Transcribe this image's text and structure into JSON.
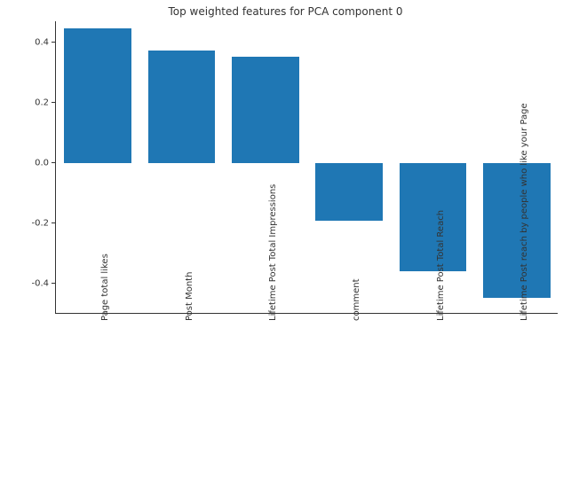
{
  "chart_data": {
    "type": "bar",
    "title": "Top weighted features for PCA component 0",
    "xlabel": "",
    "ylabel": "",
    "ylim": [
      -0.5,
      0.47
    ],
    "yticks": [
      -0.4,
      -0.2,
      0.0,
      0.2,
      0.4
    ],
    "categories": [
      "Page total likes",
      "Post Month",
      "Lifetime Post Total Impressions",
      "comment",
      "Lifetime Post Total Reach",
      "Lifetime Post reach by people who like your Page"
    ],
    "values": [
      0.447,
      0.372,
      0.353,
      -0.191,
      -0.359,
      -0.447
    ],
    "color": "#1f77b4"
  }
}
